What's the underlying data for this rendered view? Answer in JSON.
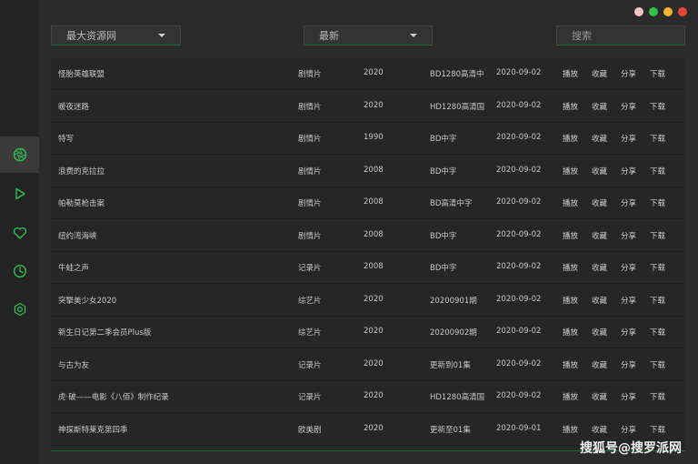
{
  "window": {
    "controls": [
      {
        "name": "window-dot-pink",
        "color": "#f2c6c6"
      },
      {
        "name": "window-dot-green",
        "color": "#2fc24a"
      },
      {
        "name": "window-dot-yellow",
        "color": "#f4b52b"
      },
      {
        "name": "window-dot-red",
        "color": "#e8463b"
      }
    ]
  },
  "sidebar": {
    "accent": "#2ebd58",
    "items": [
      {
        "icon": "aperture-icon",
        "active": true
      },
      {
        "icon": "play-icon",
        "active": false
      },
      {
        "icon": "heart-icon",
        "active": false
      },
      {
        "icon": "clock-icon",
        "active": false
      },
      {
        "icon": "gear-icon",
        "active": false
      }
    ]
  },
  "toolbar": {
    "source_select": "最大资源网",
    "sort_select": "最新",
    "search_placeholder": "搜索"
  },
  "table": {
    "rows": [
      {
        "title": "怪胎英雄联盟",
        "type": "剧情片",
        "year": "2020",
        "quality": "BD1280高清中",
        "date": "2020-09-02",
        "play": "播放",
        "fav": "收藏",
        "share": "分享",
        "download": "下载"
      },
      {
        "title": "暖夜迷路",
        "type": "剧情片",
        "year": "2020",
        "quality": "HD1280高清国",
        "date": "2020-09-02",
        "play": "播放",
        "fav": "收藏",
        "share": "分享",
        "download": "下载"
      },
      {
        "title": "特写",
        "type": "剧情片",
        "year": "1990",
        "quality": "BD中字",
        "date": "2020-09-02",
        "play": "播放",
        "fav": "收藏",
        "share": "分享",
        "download": "下载"
      },
      {
        "title": "浪费的克拉拉",
        "type": "剧情片",
        "year": "2008",
        "quality": "BD中字",
        "date": "2020-09-02",
        "play": "播放",
        "fav": "收藏",
        "share": "分享",
        "download": "下载"
      },
      {
        "title": "帕勒莫枪击案",
        "type": "剧情片",
        "year": "2008",
        "quality": "BD高清中字",
        "date": "2020-09-02",
        "play": "播放",
        "fav": "收藏",
        "share": "分享",
        "download": "下载"
      },
      {
        "title": "纽约湾海峡",
        "type": "剧情片",
        "year": "2008",
        "quality": "BD中字",
        "date": "2020-09-02",
        "play": "播放",
        "fav": "收藏",
        "share": "分享",
        "download": "下载"
      },
      {
        "title": "牛蛙之声",
        "type": "记录片",
        "year": "2008",
        "quality": "BD中字",
        "date": "2020-09-02",
        "play": "播放",
        "fav": "收藏",
        "share": "分享",
        "download": "下载"
      },
      {
        "title": "突撃美少女2020",
        "type": "综艺片",
        "year": "2020",
        "quality": "20200901期",
        "date": "2020-09-02",
        "play": "播放",
        "fav": "收藏",
        "share": "分享",
        "download": "下载"
      },
      {
        "title": "新生日记第二季会员Plus版",
        "type": "综艺片",
        "year": "2020",
        "quality": "20200902期",
        "date": "2020-09-02",
        "play": "播放",
        "fav": "收藏",
        "share": "分享",
        "download": "下载"
      },
      {
        "title": "与古为友",
        "type": "记录片",
        "year": "2020",
        "quality": "更新到01集",
        "date": "2020-09-02",
        "play": "播放",
        "fav": "收藏",
        "share": "分享",
        "download": "下载"
      },
      {
        "title": "虎·破——电影《八佰》制作纪录",
        "type": "记录片",
        "year": "2020",
        "quality": "HD1280高清国",
        "date": "2020-09-02",
        "play": "播放",
        "fav": "收藏",
        "share": "分享",
        "download": "下载"
      },
      {
        "title": "神探斯特莱克第四季",
        "type": "欧美剧",
        "year": "2020",
        "quality": "更新至01集",
        "date": "2020-09-01",
        "play": "播放",
        "fav": "收藏",
        "share": "分享",
        "download": "下载"
      }
    ]
  },
  "watermark": "搜狐号@搜罗派网"
}
